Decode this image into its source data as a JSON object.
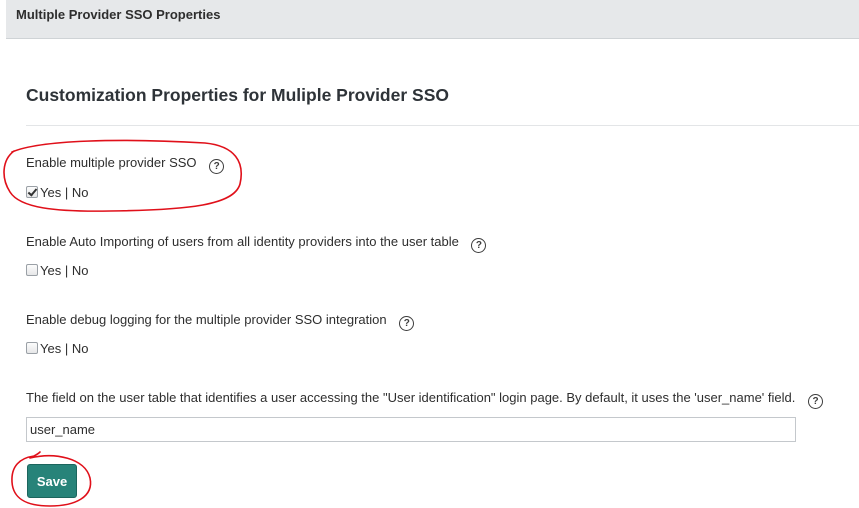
{
  "header": {
    "title": "Multiple Provider SSO Properties"
  },
  "section": {
    "title": "Customization Properties for Muliple Provider SSO"
  },
  "properties": [
    {
      "label": "Enable multiple provider SSO",
      "checked": true,
      "yes_label": "Yes",
      "separator": "|",
      "no_label": "No"
    },
    {
      "label": "Enable Auto Importing of users from all identity providers into the user table",
      "checked": false,
      "yes_label": "Yes",
      "separator": "|",
      "no_label": "No"
    },
    {
      "label": "Enable debug logging for the multiple provider SSO integration",
      "checked": false,
      "yes_label": "Yes",
      "separator": "|",
      "no_label": "No"
    }
  ],
  "identification_field": {
    "label": "The field on the user table that identifies a user accessing the \"User identification\" login page. By default, it uses the 'user_name' field.",
    "value": "user_name"
  },
  "help_glyph": "?",
  "actions": {
    "save_label": "Save"
  },
  "colors": {
    "save_button": "#278379",
    "annotation": "#e0101a",
    "header_bg": "#e6e8ea"
  }
}
